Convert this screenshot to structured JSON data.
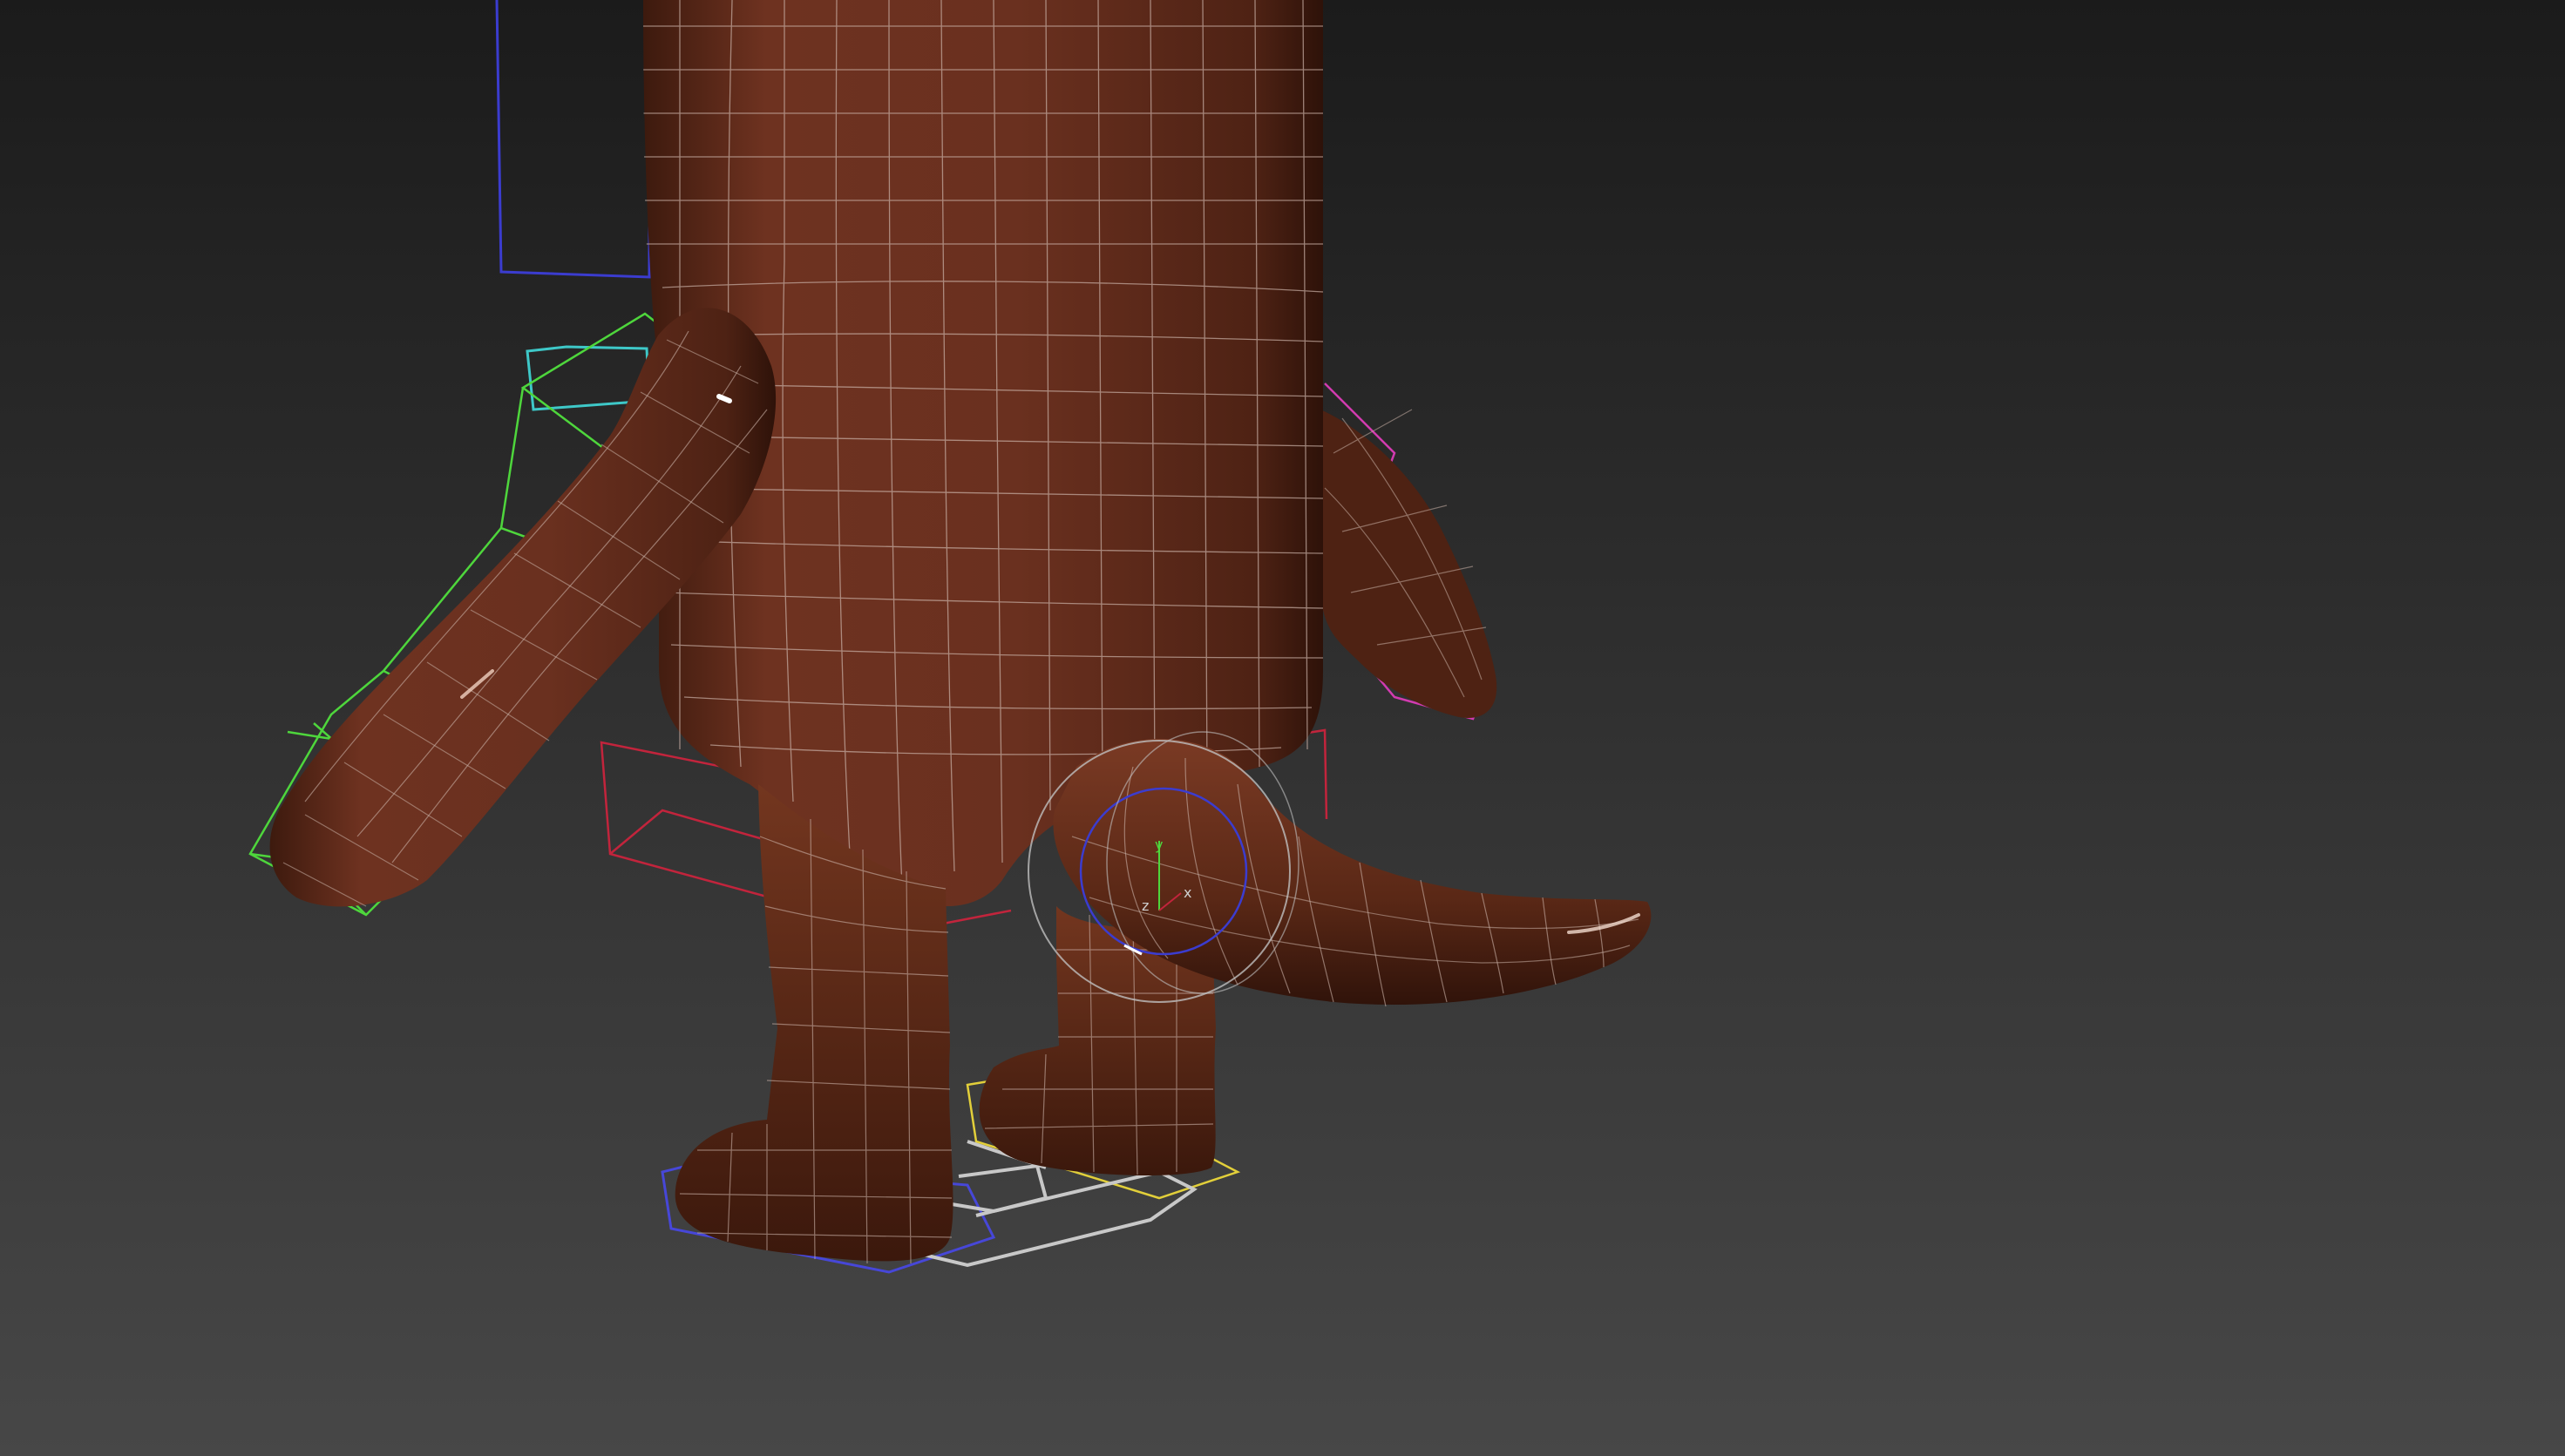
{
  "viewport": {
    "background_top": "#1b1b1b",
    "background_bottom": "#474747",
    "mesh_color": "#5c2a1a",
    "mesh_highlight": "#8a4430",
    "wire_color": "#c9b0a6",
    "gizmo_labels": {
      "x": "x",
      "y": "y",
      "z": "z"
    }
  },
  "rig_controls": {
    "arm_left_color": "#4ed63c",
    "arm_right_color": "#d23bb0",
    "pelvis_color": "#c2243c",
    "spine_color": "#3b3ccf",
    "foot_left_color": "#4747d8",
    "foot_right_color": "#e2cf3a",
    "root_color": "#c8c8c8",
    "neck_color": "#3ec8c8"
  }
}
